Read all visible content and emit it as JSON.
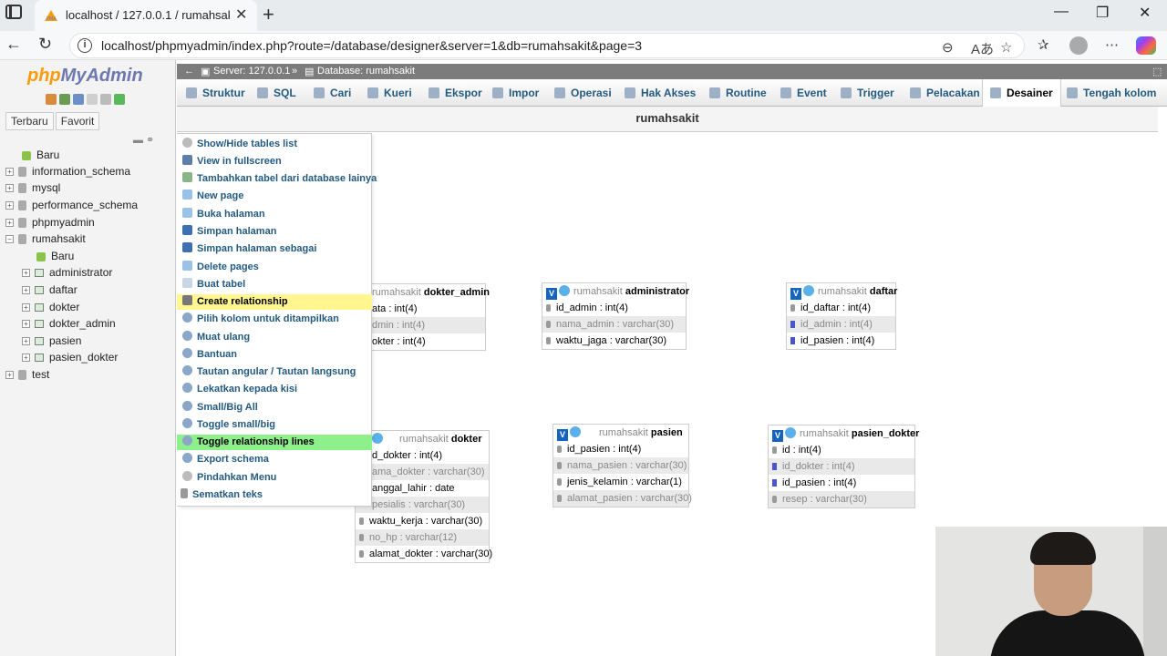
{
  "browser": {
    "tab_title": "localhost / 127.0.0.1 / rumahsakit",
    "url": "localhost/phpmyadmin/index.php?route=/database/designer&server=1&db=rumahsakit&page=3",
    "tab_close": "✕",
    "new_tab": "+",
    "minimize": "—",
    "restore": "❐",
    "close": "✕"
  },
  "sidebar": {
    "logo_php": "php",
    "logo_myadmin": "MyAdmin",
    "tabs": [
      "Terbaru",
      "Favorit"
    ],
    "tree": [
      {
        "label": "Baru",
        "type": "new"
      },
      {
        "label": "information_schema",
        "type": "db"
      },
      {
        "label": "mysql",
        "type": "db"
      },
      {
        "label": "performance_schema",
        "type": "db"
      },
      {
        "label": "phpmyadmin",
        "type": "db"
      },
      {
        "label": "rumahsakit",
        "type": "db-open"
      },
      {
        "label": "Baru",
        "type": "new-child"
      },
      {
        "label": "administrator",
        "type": "table"
      },
      {
        "label": "daftar",
        "type": "table"
      },
      {
        "label": "dokter",
        "type": "table"
      },
      {
        "label": "dokter_admin",
        "type": "table"
      },
      {
        "label": "pasien",
        "type": "table"
      },
      {
        "label": "pasien_dokter",
        "type": "table"
      },
      {
        "label": "test",
        "type": "db"
      }
    ]
  },
  "breadcrumb": {
    "server": "Server: 127.0.0.1",
    "database": "Database: rumahsakit"
  },
  "menubar": [
    "Struktur",
    "SQL",
    "Cari",
    "Kueri",
    "Ekspor",
    "Impor",
    "Operasi",
    "Hak Akses",
    "Routine",
    "Event",
    "Trigger",
    "Pelacakan",
    "Desainer",
    "Tengah kolom"
  ],
  "page_title": "rumahsakit",
  "designer_menu": [
    "Show/Hide tables list",
    "View in fullscreen",
    "Tambahkan tabel dari database lainya",
    "New page",
    "Buka halaman",
    "Simpan halaman",
    "Simpan halaman sebagai",
    "Delete pages",
    "Buat tabel",
    "Create relationship",
    "Pilih kolom untuk ditampilkan",
    "Muat ulang",
    "Bantuan",
    "Tautan angular / Tautan langsung",
    "Lekatkan kepada kisi",
    "Small/Big All",
    "Toggle small/big",
    "Toggle relationship lines",
    "Export schema",
    "Pindahkan Menu",
    "Sematkan teks"
  ],
  "tables": {
    "dokter_admin": {
      "db": "rumahsakit",
      "name": "dokter_admin",
      "columns": [
        "ata : int(4)",
        "dmin : int(4)",
        "okter : int(4)"
      ]
    },
    "administrator": {
      "db": "rumahsakit",
      "name": "administrator",
      "columns": [
        "id_admin : int(4)",
        "nama_admin : varchar(30)",
        "waktu_jaga : varchar(30)"
      ]
    },
    "daftar": {
      "db": "rumahsakit",
      "name": "daftar",
      "columns": [
        "id_daftar : int(4)",
        "id_admin : int(4)",
        "id_pasien : int(4)"
      ]
    },
    "dokter": {
      "db": "rumahsakit",
      "name": "dokter",
      "columns": [
        "d_dokter : int(4)",
        "ama_dokter : varchar(30)",
        "anggal_lahir : date",
        "pesialis : varchar(30)",
        "waktu_kerja : varchar(30)",
        "no_hp : varchar(12)",
        "alamat_dokter : varchar(30)"
      ]
    },
    "pasien": {
      "db": "rumahsakit",
      "name": "pasien",
      "columns": [
        "id_pasien : int(4)",
        "nama_pasien : varchar(30)",
        "jenis_kelamin : varchar(1)",
        "alamat_pasien : varchar(30)"
      ]
    },
    "pasien_dokter": {
      "db": "rumahsakit",
      "name": "pasien_dokter",
      "columns": [
        "id : int(4)",
        "id_dokter : int(4)",
        "id_pasien : int(4)",
        "resep : varchar(30)"
      ]
    }
  },
  "colors": {
    "menu_link": "#235a81",
    "highlight_yellow": "#fff68f",
    "highlight_green": "#8ef08a",
    "breadcrumb_bg": "#7c7c7c"
  }
}
